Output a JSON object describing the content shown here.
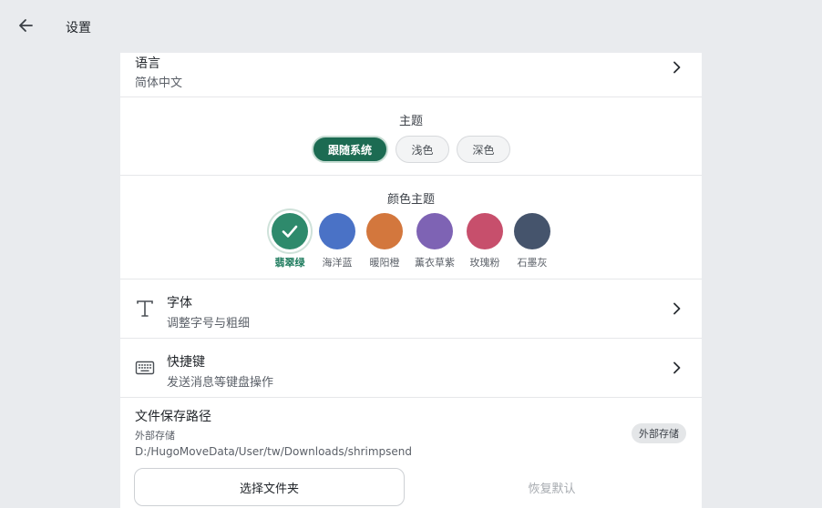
{
  "header": {
    "title": "设置",
    "back_icon": "arrow-left-icon"
  },
  "language": {
    "title": "语言",
    "value": "简体中文"
  },
  "theme": {
    "label": "主题",
    "options": [
      {
        "label": "跟随系统",
        "selected": true
      },
      {
        "label": "浅色",
        "selected": false
      },
      {
        "label": "深色",
        "selected": false
      }
    ]
  },
  "color_theme": {
    "label": "颜色主题",
    "selected": "翡翠绿",
    "options": [
      {
        "name": "翡翠绿",
        "color": "#2e8a6c"
      },
      {
        "name": "海洋蓝",
        "color": "#4a72c6"
      },
      {
        "name": "暖阳橙",
        "color": "#d3773d"
      },
      {
        "name": "薰衣草紫",
        "color": "#7e63b4"
      },
      {
        "name": "玫瑰粉",
        "color": "#c74f6c"
      },
      {
        "name": "石墨灰",
        "color": "#45546c"
      }
    ]
  },
  "font": {
    "title": "字体",
    "subtitle": "调整字号与粗细",
    "icon": "text-t-icon"
  },
  "shortcut": {
    "title": "快捷键",
    "subtitle": "发送消息等键盘操作",
    "icon": "keyboard-icon"
  },
  "save_path": {
    "title": "文件保存路径",
    "storage_label": "外部存储",
    "path": "D:/HugoMoveData/User/tw/Downloads/shrimpsend",
    "badge": "外部存储",
    "choose_button": "选择文件夹",
    "reset_button": "恢复默认"
  }
}
